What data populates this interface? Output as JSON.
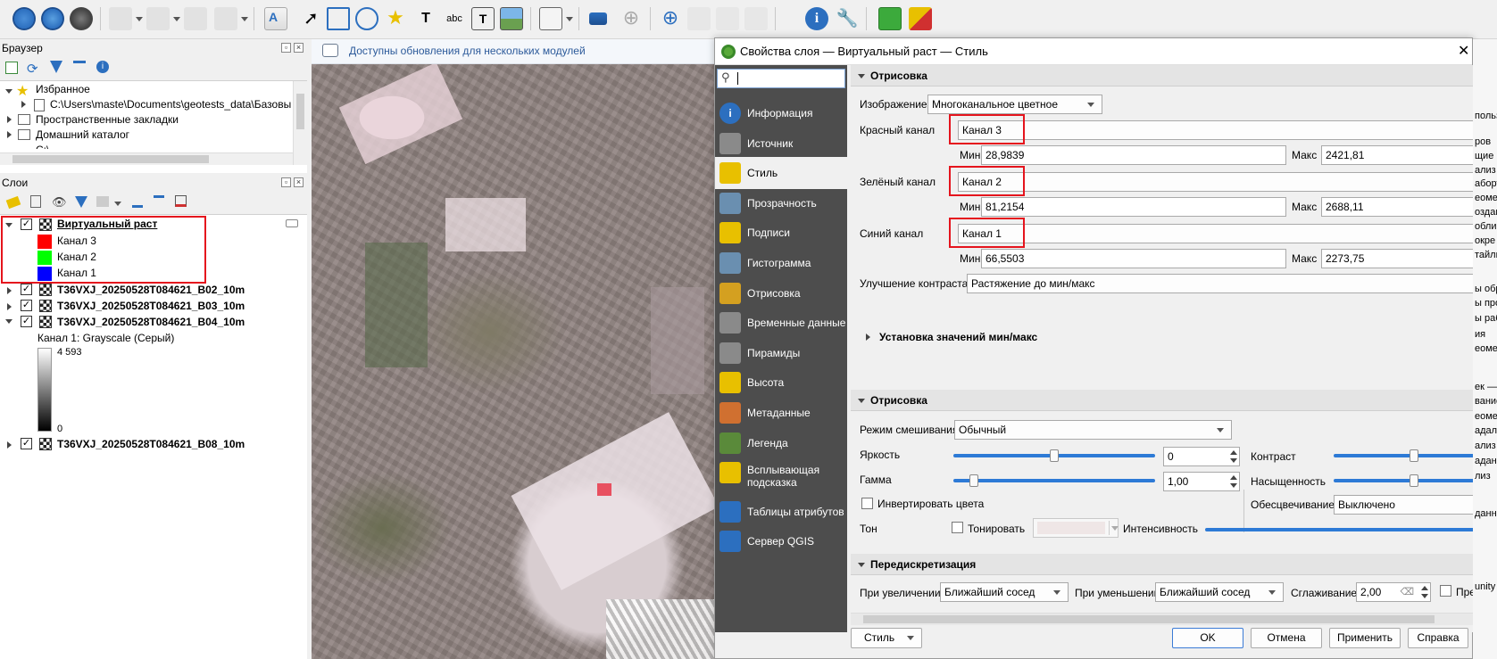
{
  "browser_panel": {
    "title": "Браузер",
    "items": [
      {
        "label": "Избранное"
      },
      {
        "label": "C:\\Users\\maste\\Documents\\geotests_data\\Базовые кар"
      },
      {
        "label": "Пространственные закладки"
      },
      {
        "label": "Домашний каталог"
      },
      {
        "label": "C:\\"
      }
    ]
  },
  "layers_panel": {
    "title": "Слои",
    "layers": [
      {
        "name": "Виртуальный раст",
        "bands": [
          {
            "label": "Канал 3",
            "color": "#ff0000"
          },
          {
            "label": "Канал 2",
            "color": "#00ff00"
          },
          {
            "label": "Канал 1",
            "color": "#0000ff"
          }
        ]
      },
      {
        "name": "T36VXJ_20250528T084621_B02_10m"
      },
      {
        "name": "T36VXJ_20250528T084621_B03_10m"
      },
      {
        "name": "T36VXJ_20250528T084621_B04_10m",
        "legend_title": "Канал 1: Grayscale (Серый)",
        "legend_max": "4 593",
        "legend_min": "0"
      },
      {
        "name": "T36VXJ_20250528T084621_B08_10m"
      }
    ]
  },
  "notification": "Доступны обновления для нескольких модулей",
  "dialog": {
    "title": "Свойства слоя — Виртуальный раст — Стиль",
    "close": "✕",
    "search_placeholder": "",
    "nav": [
      {
        "label": "Информация",
        "icon": "info-icon"
      },
      {
        "label": "Источник",
        "icon": "tools-icon"
      },
      {
        "label": "Стиль",
        "icon": "brush-icon",
        "selected": true
      },
      {
        "label": "Прозрачность",
        "icon": "transparency-icon"
      },
      {
        "label": "Подписи",
        "icon": "abc-icon"
      },
      {
        "label": "Гистограмма",
        "icon": "histogram-icon"
      },
      {
        "label": "Отрисовка",
        "icon": "paint-icon"
      },
      {
        "label": "Временные данные",
        "icon": "clock-icon"
      },
      {
        "label": "Пирамиды",
        "icon": "pyramid-icon"
      },
      {
        "label": "Высота",
        "icon": "elevation-icon"
      },
      {
        "label": "Метаданные",
        "icon": "metadata-icon"
      },
      {
        "label": "Легенда",
        "icon": "legend-icon"
      },
      {
        "label": "Всплывающая подсказка",
        "icon": "tooltip-icon"
      },
      {
        "label": "Таблицы атрибутов",
        "icon": "table-icon"
      },
      {
        "label": "Сервер QGIS",
        "icon": "server-icon"
      }
    ],
    "render_group": "Отрисовка",
    "image_label": "Изображение",
    "image_value": "Многоканальное цветное",
    "red_label": "Красный канал",
    "red_band": "Канал 3",
    "green_label": "Зелёный канал",
    "green_band": "Канал 2",
    "blue_label": "Синий канал",
    "blue_band": "Канал 1",
    "min_label": "Мин",
    "max_label": "Макс",
    "red_min": "28,9839",
    "red_max": "2421,81",
    "green_min": "81,2154",
    "green_max": "2688,11",
    "blue_min": "66,5503",
    "blue_max": "2273,75",
    "contrast_label": "Улучшение контраста",
    "contrast_value": "Растяжение до мин/макс",
    "minmax_section": "Установка значений мин/макс",
    "render2_group": "Отрисовка",
    "blend_label": "Режим смешивания",
    "blend_value": "Обычный",
    "brightness_label": "Яркость",
    "brightness_value": "0",
    "brightness_level": 0.5,
    "contrast2_label": "Контраст",
    "contrast_level": 0.5,
    "gamma_label": "Гамма",
    "gamma_value": "1,00",
    "gamma_level": 0.1,
    "saturation_label": "Насыщенность",
    "saturation_level": 0.5,
    "invert_label": "Инвертировать цвета",
    "grayscale_label": "Обесцвечивание",
    "grayscale_value": "Выключено",
    "hue_label": "Тон",
    "colorize_label": "Тонировать",
    "intensity_label": "Интенсивность",
    "resample_group": "Передискретизация",
    "zoomin_label": "При увеличении",
    "zoomin_value": "Ближайший сосед",
    "zoomout_label": "При уменьшении",
    "zoomout_value": "Ближайший сосед",
    "smooth_label": "Сглаживание",
    "smooth_value": "2,00",
    "early_label": "Пред",
    "style_button": "Стиль",
    "ok_button": "OK",
    "cancel_button": "Отмена",
    "apply_button": "Применить",
    "help_button": "Справка"
  },
  "right_edge_fragments": [
    "польз",
    "ров",
    "щие в",
    "ализ",
    "аборт",
    "еомет",
    "оздан",
    "облиц",
    "окре",
    "тайлы",
    "ы обр",
    "ы про",
    "ы раб",
    "ия",
    "еомет",
    "ек —",
    "вание",
    "еомет",
    "адал",
    "ализ р",
    "адани",
    "лиз",
    "данн",
    "unity"
  ],
  "colors": {
    "accent": "#2d7ad6",
    "highlight": "#e5141d",
    "nav_bg": "#4d4d4d"
  }
}
